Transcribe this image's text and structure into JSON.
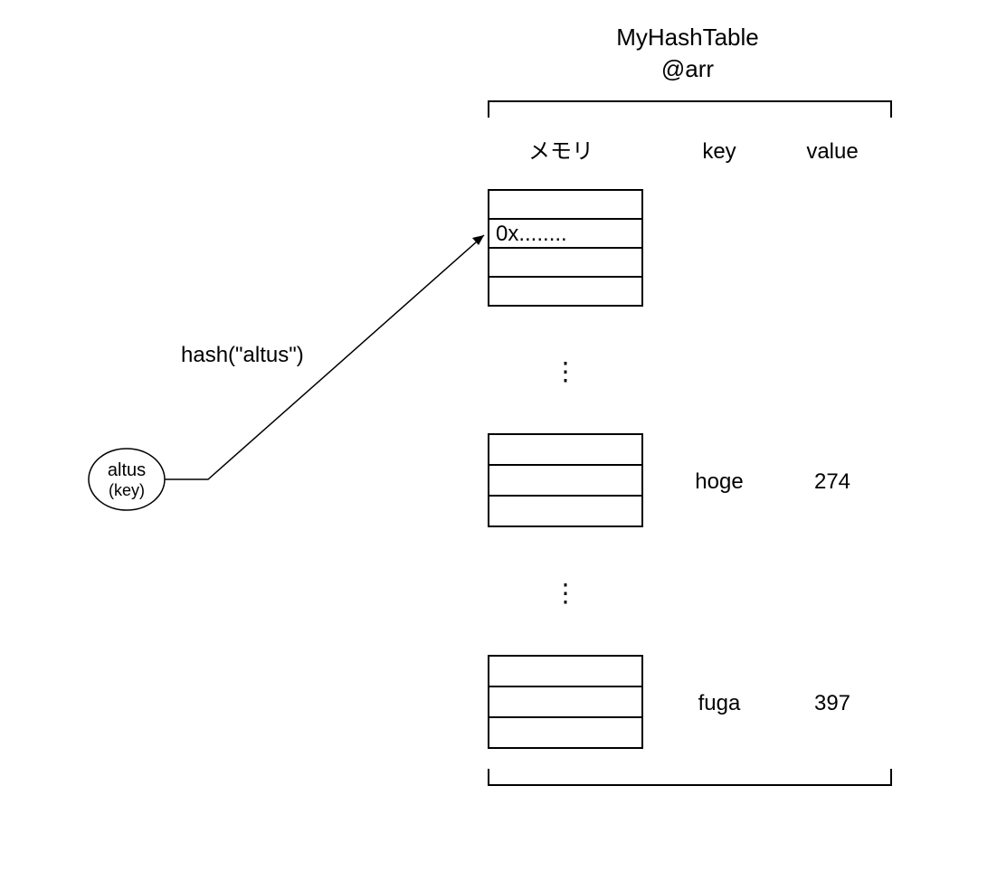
{
  "title": {
    "line1": "MyHashTable",
    "line2": "@arr"
  },
  "columns": {
    "memory": "メモリ",
    "key": "key",
    "value": "value"
  },
  "input": {
    "key_name": "altus",
    "key_caption": "(key)"
  },
  "hash_label": "hash(\"altus\")",
  "memory_cell": "0x........",
  "ellipsis": "⋮",
  "entries": [
    {
      "key": "hoge",
      "value": "274"
    },
    {
      "key": "fuga",
      "value": "397"
    }
  ]
}
